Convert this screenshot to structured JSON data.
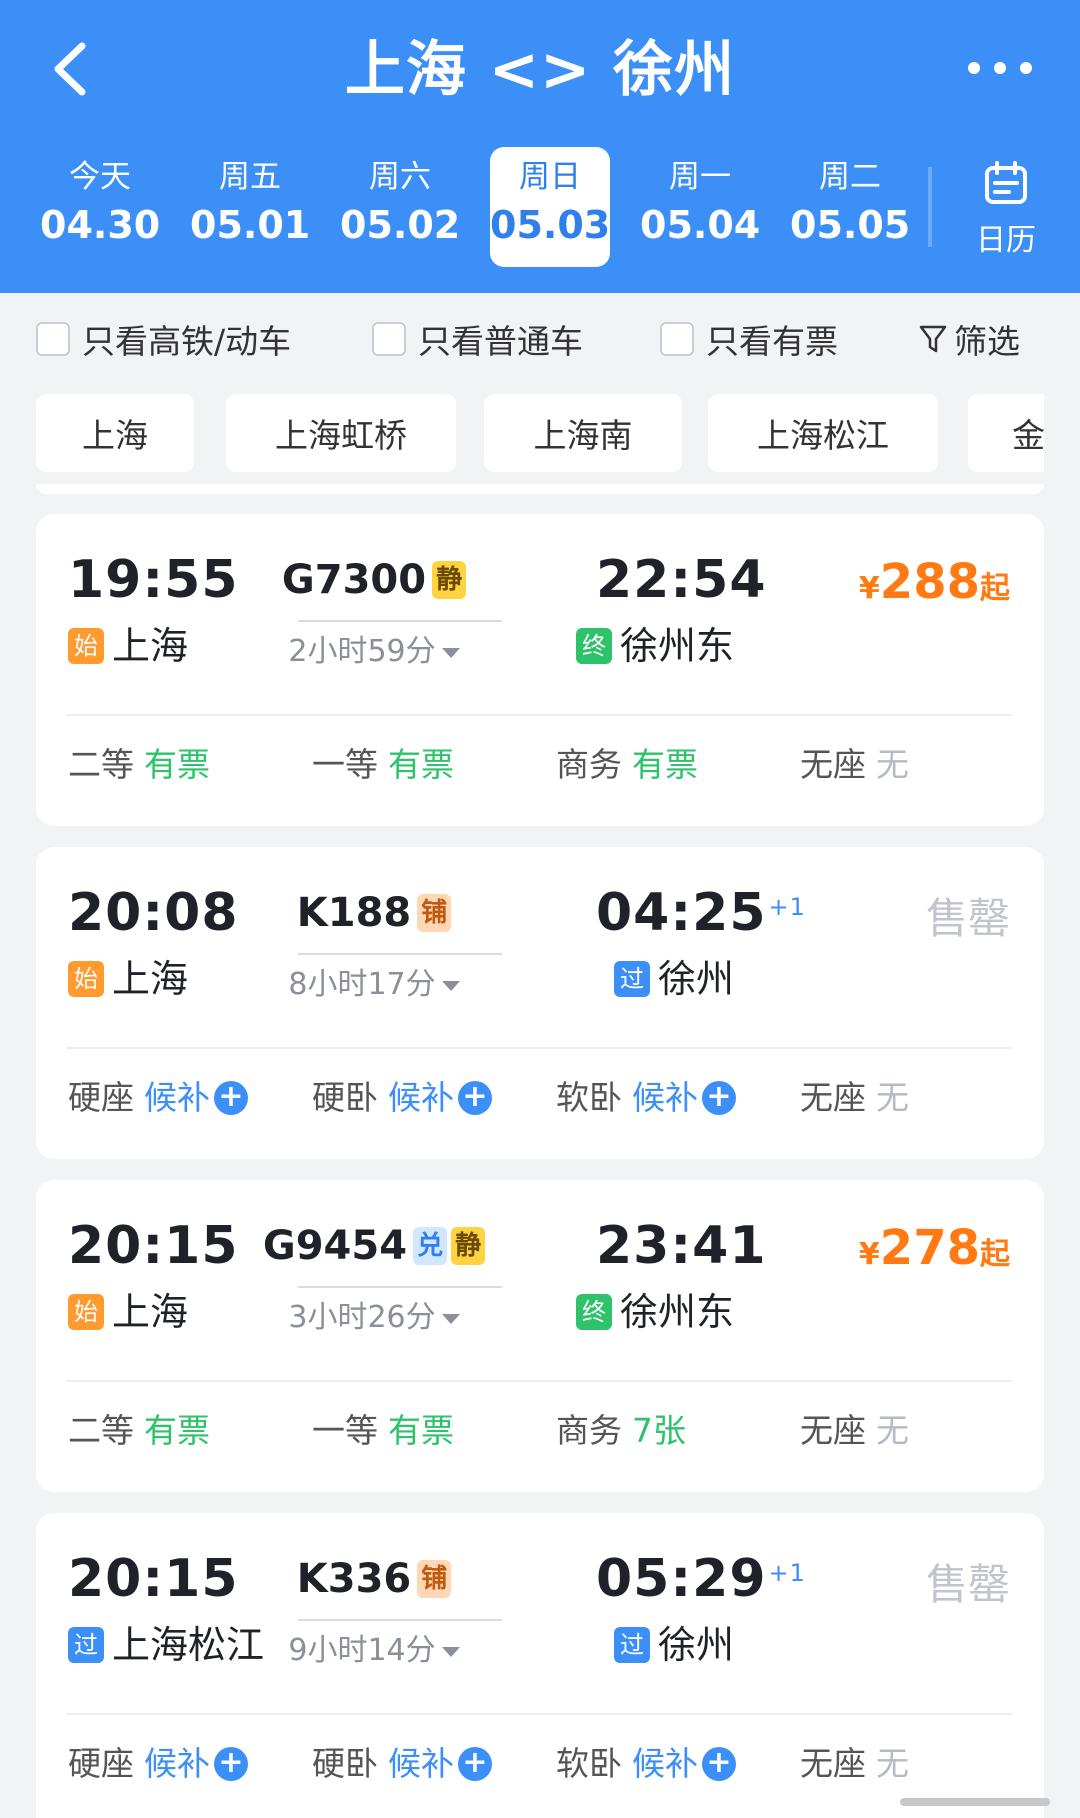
{
  "header": {
    "title": "上海 <> 徐州"
  },
  "dates": [
    {
      "weekday": "今天",
      "date": "04.30",
      "active": false
    },
    {
      "weekday": "周五",
      "date": "05.01",
      "active": false
    },
    {
      "weekday": "周六",
      "date": "05.02",
      "active": false
    },
    {
      "weekday": "周日",
      "date": "05.03",
      "active": true
    },
    {
      "weekday": "周一",
      "date": "05.04",
      "active": false
    },
    {
      "weekday": "周二",
      "date": "05.05",
      "active": false
    }
  ],
  "calendar_label": "日历",
  "filters": {
    "high_speed": "只看高铁/动车",
    "normal": "只看普通车",
    "available": "只看有票",
    "filter": "筛选"
  },
  "stations": [
    "上海",
    "上海虹桥",
    "上海南",
    "上海松江",
    "金"
  ],
  "trains": [
    {
      "dep_time": "19:55",
      "dep_tag": "始",
      "dep_station": "上海",
      "train_no": "G7300",
      "badges": [
        "静"
      ],
      "duration": "2小时59分",
      "arr_time": "22:54",
      "arr_plus": "",
      "arr_tag": "终",
      "arr_station": "徐州东",
      "price": "288",
      "price_prefix": "¥",
      "price_suffix": "起",
      "soldout": "",
      "seats": [
        {
          "name": "二等",
          "status": "有票",
          "kind": "green",
          "add": false
        },
        {
          "name": "一等",
          "status": "有票",
          "kind": "green",
          "add": false
        },
        {
          "name": "商务",
          "status": "有票",
          "kind": "green",
          "add": false
        },
        {
          "name": "无座",
          "status": "无",
          "kind": "gray",
          "add": false
        }
      ]
    },
    {
      "dep_time": "20:08",
      "dep_tag": "始",
      "dep_station": "上海",
      "train_no": "K188",
      "badges": [
        "铺"
      ],
      "duration": "8小时17分",
      "arr_time": "04:25",
      "arr_plus": "+1",
      "arr_tag": "过",
      "arr_station": "徐州",
      "price": "",
      "price_prefix": "",
      "price_suffix": "",
      "soldout": "售罄",
      "seats": [
        {
          "name": "硬座",
          "status": "候补",
          "kind": "blue",
          "add": true
        },
        {
          "name": "硬卧",
          "status": "候补",
          "kind": "blue",
          "add": true
        },
        {
          "name": "软卧",
          "status": "候补",
          "kind": "blue",
          "add": true
        },
        {
          "name": "无座",
          "status": "无",
          "kind": "gray",
          "add": false
        }
      ]
    },
    {
      "dep_time": "20:15",
      "dep_tag": "始",
      "dep_station": "上海",
      "train_no": "G9454",
      "badges": [
        "兑",
        "静"
      ],
      "duration": "3小时26分",
      "arr_time": "23:41",
      "arr_plus": "",
      "arr_tag": "终",
      "arr_station": "徐州东",
      "price": "278",
      "price_prefix": "¥",
      "price_suffix": "起",
      "soldout": "",
      "seats": [
        {
          "name": "二等",
          "status": "有票",
          "kind": "green",
          "add": false
        },
        {
          "name": "一等",
          "status": "有票",
          "kind": "green",
          "add": false
        },
        {
          "name": "商务",
          "status": "7张",
          "kind": "green",
          "add": false
        },
        {
          "name": "无座",
          "status": "无",
          "kind": "gray",
          "add": false
        }
      ]
    },
    {
      "dep_time": "20:15",
      "dep_tag": "过",
      "dep_station": "上海松江",
      "train_no": "K336",
      "badges": [
        "铺"
      ],
      "duration": "9小时14分",
      "arr_time": "05:29",
      "arr_plus": "+1",
      "arr_tag": "过",
      "arr_station": "徐州",
      "price": "",
      "price_prefix": "",
      "price_suffix": "",
      "soldout": "售罄",
      "seats": [
        {
          "name": "硬座",
          "status": "候补",
          "kind": "blue",
          "add": true
        },
        {
          "name": "硬卧",
          "status": "候补",
          "kind": "blue",
          "add": true
        },
        {
          "name": "软卧",
          "status": "候补",
          "kind": "blue",
          "add": true
        },
        {
          "name": "无座",
          "status": "无",
          "kind": "gray",
          "add": false
        }
      ]
    }
  ]
}
